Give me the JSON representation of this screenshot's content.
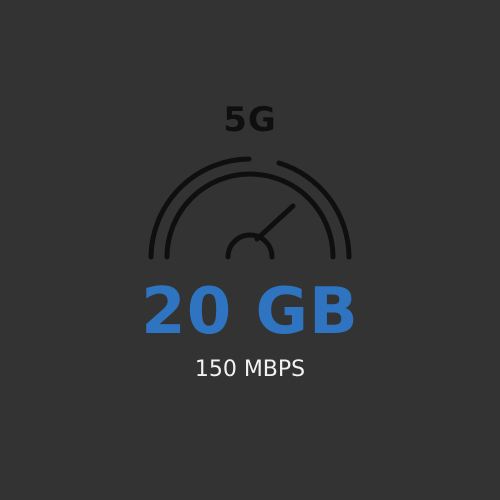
{
  "plan": {
    "network": "5G",
    "data_amount": "20 GB",
    "speed": "150 MBPS"
  },
  "icons": {
    "gauge": "speedometer-icon"
  },
  "colors": {
    "background": "#333333",
    "accent": "#2f74c0",
    "icon": "#0f0f0f",
    "text": "#f2f2f2"
  }
}
